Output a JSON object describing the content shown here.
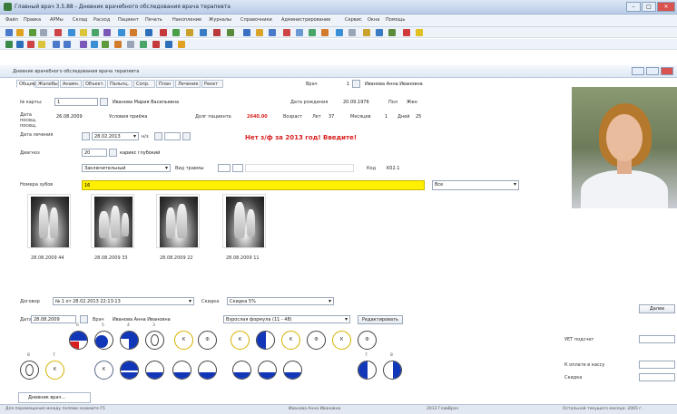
{
  "window": {
    "title": "Главный врач 3.5.88 - Дневник врачебного обследования врача терапевта"
  },
  "menu": [
    "Файл",
    "Правка",
    "АРМы",
    "Склад",
    "Расход",
    "Пациент",
    "Печать",
    "Накопление",
    "Журналы",
    "Справочники",
    "Администрирование",
    "Сервис",
    "Окна",
    "Помощь"
  ],
  "subwindow": {
    "title": "Дневник врачебного обследования врача терапевта"
  },
  "tabs": [
    "Общие",
    "Жалобы",
    "Анамн.",
    "Объект.",
    "Пальпц.",
    "Сопр.",
    "План",
    "Лечение",
    "Рекет"
  ],
  "form": {
    "card_label": "№ карты:",
    "card_value": "1",
    "patient_name": "Иванова Мария Васильевна",
    "visit_date_label": "Дата посещ. посещ.",
    "visit_date": "26.08.2009",
    "terms_label": "Условия приёма",
    "debt_label": "Долг пациента",
    "debt_value": "2640.00",
    "doctor_label": "Врач",
    "doctor_num": "1",
    "doctor_name": "Иванова Анна Ивановна",
    "birth_label": "Дата рождения",
    "birth_date": "20.09.1976",
    "sex_label": "Пол",
    "sex_value": "Жен",
    "age_label": "Возраст",
    "age_years_label": "Лет",
    "age_years": "37",
    "age_months_label": "Месяцев",
    "age_months": "1",
    "age_days_label": "Дней",
    "age_days": "25",
    "treat_date_label": "Дата лечения",
    "treat_date": "28.02.2013",
    "visit_no_label": "н/з",
    "warning": "Нет з/ф за 2013 год! Введите!",
    "diagnosis_label": "Диагноз",
    "diagnosis_code": "20",
    "diagnosis_text": "кариес глубокий",
    "status_select": "Заключительный",
    "injury_label": "Вид травмы",
    "mkb_label": "Код",
    "mkb_value": "K02.1",
    "teeth_label": "Номера зубов",
    "teeth_value": "16",
    "teeth_scope": "Все"
  },
  "xrays": [
    {
      "caption": "28.08.2009 44"
    },
    {
      "caption": "28.08.2009 33"
    },
    {
      "caption": "28.08.2009 22"
    },
    {
      "caption": "28.08.2009 11"
    }
  ],
  "bottom": {
    "contract_label": "Договор",
    "contract_value": "№ 1 от 28.02.2013 22:13:13",
    "discount_label": "Скидка",
    "discount_value": "Скидка 5%",
    "date_label": "Дата",
    "date_value": "28.08.2009",
    "doctor_label": "Врач",
    "doctor_value": "Иванова Анна Ивановна",
    "formula_select": "Взрослая формула (11 - 48)",
    "edit_button": "Редактировать",
    "next_button": "Далее",
    "uet_label": "УЕТ подсчет",
    "to_pay_label": "К оплате в кассу",
    "discount2_label": "Скидка"
  },
  "teeth_upper": [
    {
      "num": "6",
      "letter": "",
      "kind": "fill-red"
    },
    {
      "num": "5",
      "letter": "",
      "kind": "fill-mid"
    },
    {
      "num": "4",
      "letter": "",
      "kind": "fill-top"
    },
    {
      "num": "3",
      "letter": "",
      "kind": "sym"
    },
    {
      "num": "",
      "letter": "К",
      "kind": "y"
    },
    {
      "num": "",
      "letter": "Ф",
      "kind": "plain"
    },
    {
      "num": "",
      "letter": "К",
      "kind": "y"
    },
    {
      "num": "",
      "letter": "",
      "kind": "fill-left"
    },
    {
      "num": "",
      "letter": "К",
      "kind": "y"
    },
    {
      "num": "",
      "letter": "Ф",
      "kind": "plain"
    },
    {
      "num": "",
      "letter": "К",
      "kind": "y"
    },
    {
      "num": "",
      "letter": "Ф",
      "kind": "plain"
    }
  ],
  "teeth_lower": [
    {
      "num": "8",
      "letter": "",
      "kind": "sym"
    },
    {
      "num": "7",
      "letter": "К",
      "kind": "y"
    },
    {
      "num": "",
      "letter": "К",
      "kind": "n"
    },
    {
      "num": "",
      "letter": "",
      "kind": "fill-full"
    },
    {
      "num": "",
      "letter": "",
      "kind": "fill-bot"
    },
    {
      "num": "",
      "letter": "",
      "kind": "fill-bot"
    },
    {
      "num": "",
      "letter": "",
      "kind": "fill-bot"
    },
    {
      "num": "",
      "letter": "",
      "kind": "fill-bot"
    },
    {
      "num": "",
      "letter": "",
      "kind": "fill-bot"
    },
    {
      "num": "",
      "letter": "",
      "kind": "fill-bot"
    },
    {
      "num": "7",
      "letter": "",
      "kind": "fill-left"
    },
    {
      "num": "8",
      "letter": "",
      "kind": "fill-right"
    }
  ],
  "taskbar": {
    "tab": "Дневник врач..."
  },
  "status": [
    "Для перемещения между полями нажмите F5",
    "Иванова Анна Ивановна",
    "2013 ГлавВрач",
    "Остальной текущего месяца: 2065 г."
  ],
  "colors": {
    "warning": "#d81f1f",
    "teeth_bar": "#ffef00",
    "tooth_fill": "#1136b8",
    "tooth_red": "#d81f1f"
  }
}
